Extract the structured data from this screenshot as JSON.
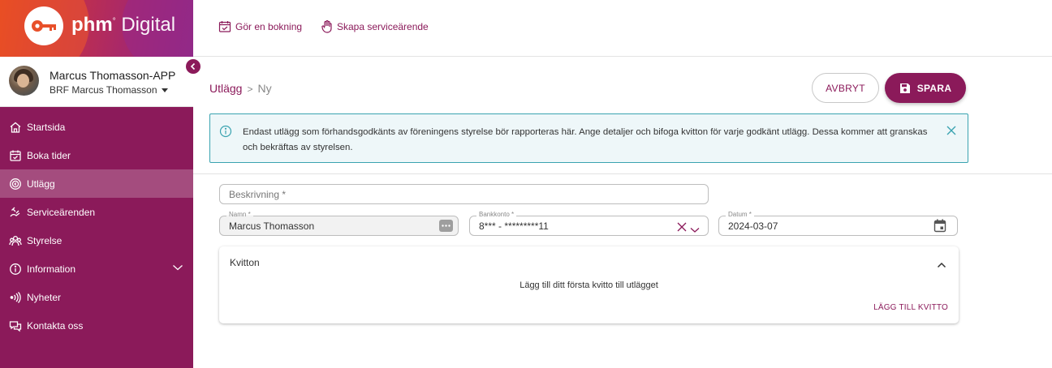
{
  "brand": {
    "name_bold": "phm",
    "name_light": "Digital",
    "reg_mark": "°"
  },
  "colors": {
    "primary": "#8b1a5a",
    "info_border": "#3aa3b0",
    "info_bg": "#eef7f9"
  },
  "user": {
    "name": "Marcus Thomasson-APP",
    "organization": "BRF Marcus Thomasson"
  },
  "topbar": {
    "links": [
      {
        "label": "Gör en bokning",
        "icon": "calendar-check-icon"
      },
      {
        "label": "Skapa serviceärende",
        "icon": "hand-icon"
      }
    ]
  },
  "sidebar": {
    "items": [
      {
        "label": "Startsida",
        "icon": "home-icon"
      },
      {
        "label": "Boka tider",
        "icon": "calendar-icon"
      },
      {
        "label": "Utlägg",
        "icon": "expense-icon",
        "active": true
      },
      {
        "label": "Serviceärenden",
        "icon": "service-icon"
      },
      {
        "label": "Styrelse",
        "icon": "board-icon"
      },
      {
        "label": "Information",
        "icon": "info-icon",
        "expandable": true
      },
      {
        "label": "Nyheter",
        "icon": "news-icon"
      },
      {
        "label": "Kontakta oss",
        "icon": "contact-icon"
      }
    ]
  },
  "breadcrumb": {
    "parent": "Utlägg",
    "separator": ">",
    "current": "Ny"
  },
  "actions": {
    "cancel_label": "AVBRYT",
    "save_label": "SPARA"
  },
  "alert": {
    "text": "Endast utlägg som förhandsgodkänts av föreningens styrelse bör rapporteras här. Ange detaljer och bifoga kvitton för varje godkänt utlägg. Dessa kommer att granskas och bekräftas av styrelsen."
  },
  "form": {
    "description": {
      "placeholder": "Beskrivning *"
    },
    "name": {
      "label": "Namn *",
      "value": "Marcus Thomasson"
    },
    "bank_account": {
      "label": "Bankkonto *",
      "value": "8*** - *********11"
    },
    "date": {
      "label": "Datum *",
      "value": "2024-03-07"
    }
  },
  "receipts": {
    "title": "Kvitton",
    "empty_text": "Lägg till ditt första kvitto till utlägget",
    "add_label": "LÄGG TILL KVITTO"
  }
}
